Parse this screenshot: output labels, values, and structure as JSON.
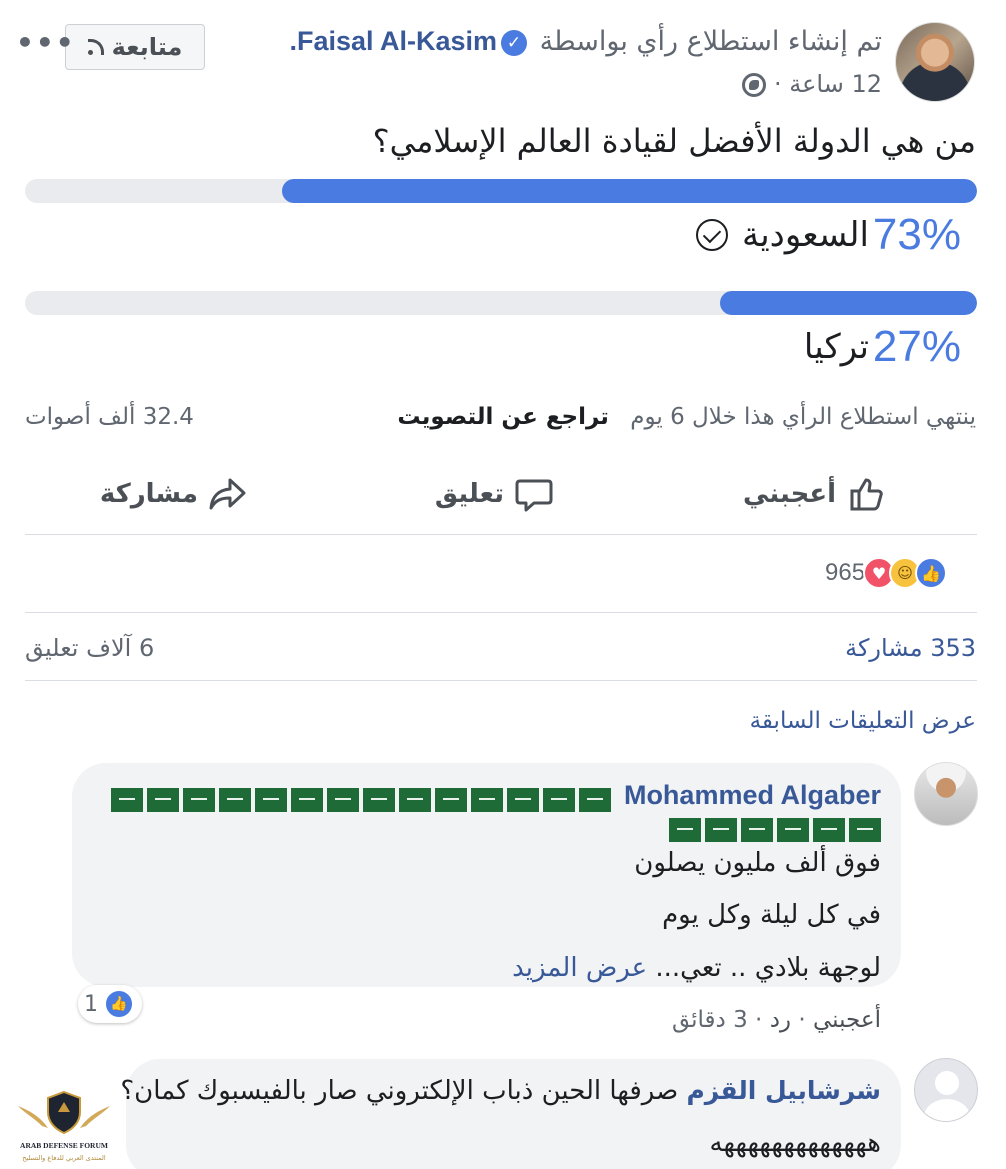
{
  "post": {
    "author": "Faisal Al-Kasim",
    "created_text": "تم إنشاء استطلاع رأي بواسطة",
    "time": "12 ساعة ·",
    "follow_label": "متابعة",
    "question": "من هي الدولة الأفضل لقيادة العالم الإسلامي؟"
  },
  "poll": {
    "options": [
      {
        "percent_label": "73%",
        "label": "السعودية",
        "fraction": 0.73
      },
      {
        "percent_label": "27%",
        "label": "تركيا",
        "fraction": 0.27
      }
    ],
    "ends_text": "ينتهي استطلاع الرأي هذا خلال 6 يوم",
    "undo_vote": "تراجع عن التصويت",
    "votes_text": "32.4 ألف أصوات"
  },
  "actions": {
    "like": "أعجبني",
    "comment": "تعليق",
    "share": "مشاركة"
  },
  "reactions": {
    "count": "965"
  },
  "stats": {
    "shares": "353 مشاركة",
    "comments": "6 آلاف تعليق"
  },
  "view_previous": "عرض التعليقات السابقة",
  "comments": [
    {
      "author": "Mohammed Algaber",
      "lines": [
        "فوق ألف مليون يصلون",
        "في كل ليلة وكل يوم",
        "لوجهة بلادي .. تعي..."
      ],
      "see_more": "عرض المزيد",
      "like_count": "1",
      "like_action": "أعجبني",
      "reply_action": "رد",
      "time": "3 دقائق"
    },
    {
      "author": "شرشابيل القزم",
      "line1": "صرفها الحين ذباب الإلكتروني صار بالفيسبوك كمان؟",
      "line2": "هههههههههههههه"
    }
  ],
  "watermark": {
    "line1": "ARAB DEFENSE FORUM",
    "line2": "المنتدى العربي للدفاع والتسليح"
  },
  "colors": {
    "accent": "#4a7be0",
    "link": "#385898",
    "track": "#e9ebee",
    "bubble": "#f2f3f5"
  }
}
